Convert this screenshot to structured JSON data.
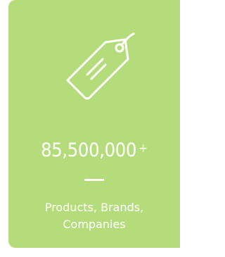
{
  "card": {
    "background_color": "#b5dc7a",
    "icon": "price-tag-icon",
    "stat": {
      "number": "85,500,000",
      "suffix": "+"
    },
    "caption": {
      "line1": "Products, Brands,",
      "line2": "Companies"
    }
  }
}
